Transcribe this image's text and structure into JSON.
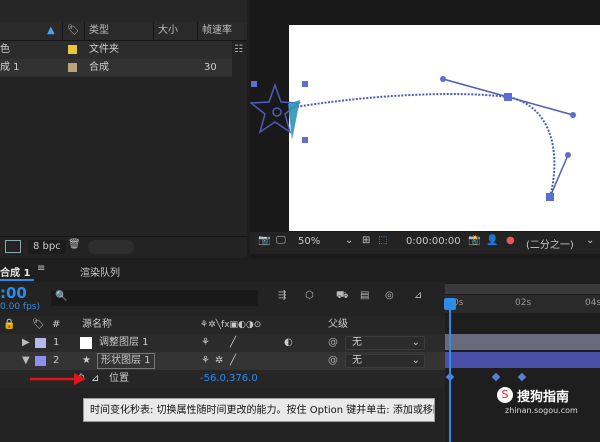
{
  "project_panel": {
    "columns": {
      "type": "类型",
      "size": "大小",
      "fps": "帧速率"
    },
    "items": [
      {
        "name": "色",
        "type": "文件夹",
        "fps": "",
        "swatch": "#e8c53a"
      },
      {
        "name": "成 1",
        "type": "合成",
        "fps": "30",
        "swatch": "#b9a37a"
      }
    ],
    "footer": {
      "bpc": "8 bpc"
    }
  },
  "viewer": {
    "zoom": "50%",
    "timecode": "0:00:00:00",
    "resolution": "(二分之一)"
  },
  "timeline": {
    "tab_comp": "合成 1",
    "tab_render": "渲染队列",
    "current_time": ":00",
    "fps_note": "0.00 fps)",
    "search_placeholder": "",
    "col_layer_name": "源名称",
    "col_parent": "父级",
    "ruler_labels": [
      "0s",
      "02s",
      "04s"
    ],
    "layers": [
      {
        "num": "1",
        "name": "调整图层 1",
        "parent": "无",
        "color": "#b7b7e9"
      },
      {
        "num": "2",
        "name": "形状图层 1",
        "parent": "无",
        "color": "#8f8ff0"
      }
    ],
    "property": {
      "name": "位置",
      "value": "-56.0,376.0"
    },
    "tooltip": "时间变化秒表: 切换属性随时间更改的能力。按住 Option 键并单击: 添加或移除表达式。"
  },
  "watermark": {
    "text": "搜狗指南",
    "url": "zhinan.sogou.com"
  },
  "colors": {
    "accent_blue": "#2d8ceb",
    "path_blue": "#4e5bb8",
    "keyframe_blue": "#5b7fd9"
  }
}
